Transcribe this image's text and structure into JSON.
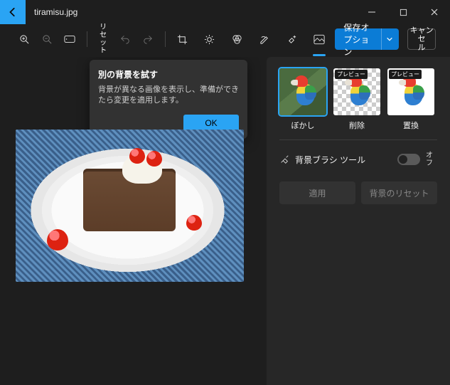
{
  "titlebar": {
    "filename": "tiramisu.jpg"
  },
  "toolbar": {
    "reset_label": "リセ\nット",
    "save_label": "保存オプション",
    "cancel_label": "キャンセ\nル"
  },
  "popover": {
    "title": "別の背景を試す",
    "body": "背景が異なる画像を表示し、準備ができたら変更を適用します。",
    "ok_label": "OK"
  },
  "panel": {
    "options": [
      {
        "label": "ぼかし",
        "preview": false,
        "selected": true
      },
      {
        "label": "削除",
        "preview": true,
        "selected": false
      },
      {
        "label": "置換",
        "preview": true,
        "selected": false
      }
    ],
    "preview_tag": "プレビュー",
    "brush_label": "背景ブラシ ツール",
    "toggle_state": "オフ",
    "apply_label": "適用",
    "reset_bg_label": "背景のリセット"
  }
}
